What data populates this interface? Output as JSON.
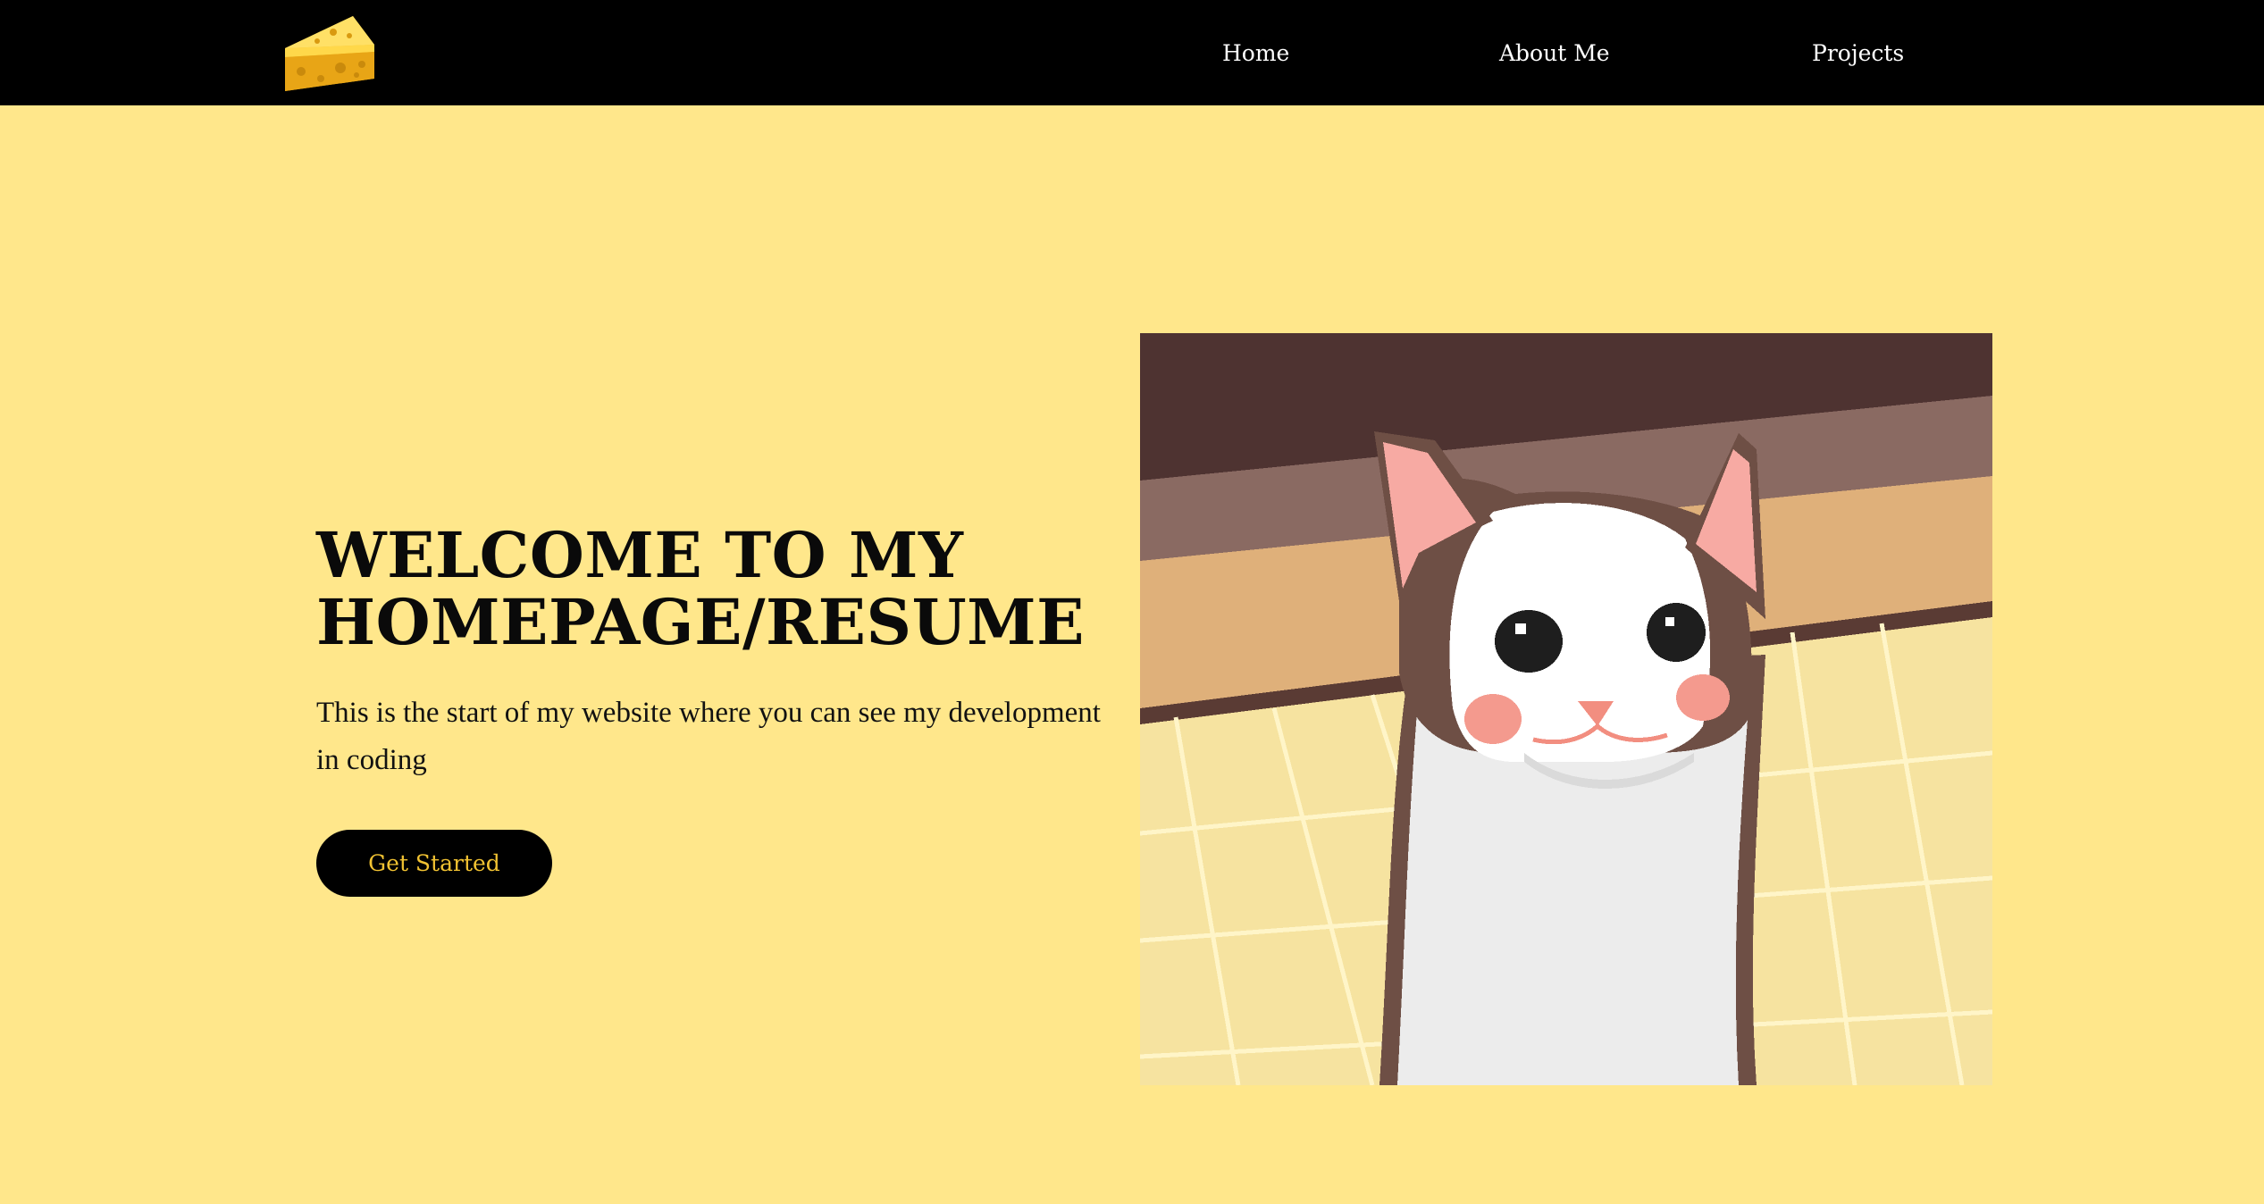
{
  "nav": {
    "logo_icon": "cheese-icon",
    "links": [
      {
        "label": "Home"
      },
      {
        "label": "About Me"
      },
      {
        "label": "Projects"
      }
    ]
  },
  "hero": {
    "title": "WELCOME TO MY HOMEPAGE/RESUME",
    "text": "This is the start of my website where you can see my development in coding",
    "button_label": "Get Started",
    "image_subject": "pixel-art-pop-cat"
  },
  "colors": {
    "background": "#ffe78b",
    "navbar": "#000000",
    "nav_text": "#ffffff",
    "button_bg": "#000000",
    "button_text": "#f1c232"
  }
}
